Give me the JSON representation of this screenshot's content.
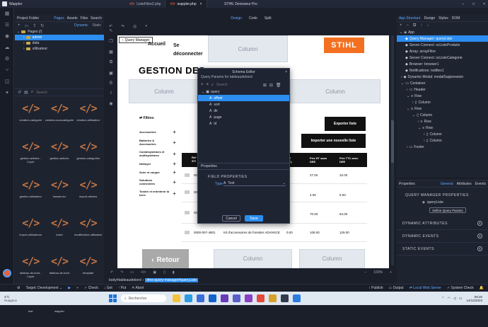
{
  "window": {
    "app_title": "Wappler",
    "title": "STIHL Devisseur Pro",
    "window_controls": [
      "–",
      "□",
      "×"
    ]
  },
  "editor_tabs": [
    {
      "label": "ListeFiltre2.php",
      "active": false
    },
    {
      "label": "wappler.php",
      "active": true
    }
  ],
  "view_modes": [
    "Design",
    "Code",
    "Split"
  ],
  "project": {
    "panel_title": "Project Folder",
    "tabs": [
      "Pages",
      "Assets",
      "Files",
      "Search"
    ],
    "modes": [
      "Dynamic",
      "Static"
    ],
    "tree": [
      {
        "label": "Pages (/)",
        "level": 0,
        "selected": false
      },
      {
        "label": "admin",
        "level": 1,
        "selected": true
      },
      {
        "label": "data",
        "level": 1,
        "selected": false
      },
      {
        "label": "utilisateur",
        "level": 1,
        "selected": false
      }
    ],
    "search_placeholder": "Search",
    "files": [
      "creation-categorie",
      "creation-souscategorie",
      "creation-utilisateur",
      "gestion-articles - Copie",
      "gestion-articles",
      "gestion-categories",
      "gestion-utilisateur",
      "header.inc",
      "import-articles",
      "import-utilisateurs",
      "index",
      "modification-utilisateur",
      "tableau-de-bord - Copie",
      "tableau-de-bord",
      "template",
      "test",
      "wappler"
    ]
  },
  "canvas": {
    "query_manager_label": "Query Manager",
    "nav_links": [
      "Accueil",
      "Se déconnecter"
    ],
    "column_label": "Column",
    "logo": "STIHL",
    "page_title": "GESTION DES",
    "filters_label": "Filtres",
    "filters": [
      "Accessoires",
      "Batteries & Accessoires",
      "Combisystèmes et multisystèmes",
      "Nettoyer",
      "Scier et couper",
      "Solutions connectées",
      "Tondre et entretenir la terre"
    ],
    "btn_export": "Exporter liste",
    "btn_import": "Importer une nouvelle liste",
    "table_headers": [
      "Réf STI",
      "",
      "EE TC)",
      "Prix HT sans DEE",
      "Prix TTC avec DEE"
    ],
    "rows": [
      {
        "ref": "0000",
        "designation": "",
        "ee": "",
        "ht": "27.00",
        "ttc": "32.00"
      },
      {
        "ref": "0000",
        "designation": "",
        "ee": "",
        "ht": "4.00",
        "ttc": "5.00"
      },
      {
        "ref": "0000",
        "designation": "",
        "ee": "",
        "ht": "70.00",
        "ttc": "84.00"
      },
      {
        "ref": "0000-007-4801",
        "designation": "Kit d'accessoires de forestier ADVANCE",
        "ee": "0.00",
        "ht": "108.00",
        "ttc": "129.00"
      }
    ],
    "btn_retour": "Retour"
  },
  "schema_editor": {
    "title": "Schema Editor",
    "subtitle": "Query Params for tableaudebord",
    "search_placeholder": "Search",
    "root": "query",
    "params": [
      "offset",
      "sort",
      "dir",
      "page",
      "id"
    ],
    "selected": "offset",
    "properties_label": "Properties",
    "field_properties": "FIELD PROPERTIES",
    "type_label": "Type",
    "type_value": "Text",
    "cancel": "Cancel",
    "save": "Save"
  },
  "app_structure": {
    "tabs": [
      "App Structure",
      "Design",
      "Styles",
      "DOM"
    ],
    "items": [
      {
        "label": "App",
        "level": 0,
        "selected": false
      },
      {
        "label": "Query Manager: queryListe",
        "level": 1,
        "selected": true
      },
      {
        "label": "Server Connect: scListeProduits",
        "level": 1,
        "selected": false
      },
      {
        "label": "Array: arrayFiltre",
        "level": 1,
        "selected": false
      },
      {
        "label": "Server Connect: scListeCategorie",
        "level": 1,
        "selected": false
      },
      {
        "label": "Browser: browser1",
        "level": 1,
        "selected": false
      },
      {
        "label": "Notifications: notifies1",
        "level": 1,
        "selected": false
      },
      {
        "label": "Dynamic Modal: modalSuppression",
        "level": 1,
        "selected": false
      },
      {
        "label": "Container",
        "level": 1,
        "selected": false
      },
      {
        "label": "Header",
        "level": 2,
        "selected": false
      },
      {
        "label": "Row",
        "level": 2,
        "selected": false
      },
      {
        "label": "Column",
        "level": 3,
        "selected": false
      },
      {
        "label": "Row",
        "level": 2,
        "selected": false
      },
      {
        "label": "Column",
        "level": 3,
        "selected": false
      },
      {
        "label": "Row",
        "level": 4,
        "selected": false
      },
      {
        "label": "Row",
        "level": 4,
        "selected": false
      },
      {
        "label": "Column",
        "level": 5,
        "selected": false
      },
      {
        "label": "Column",
        "level": 5,
        "selected": false
      },
      {
        "label": "Footer",
        "level": 2,
        "selected": false
      }
    ]
  },
  "properties": {
    "title": "Properties",
    "tabs": [
      "General",
      "Attributes",
      "Events"
    ],
    "query_manager_props": "QUERY MANAGER PROPERTIES",
    "query_name": "queryListe",
    "define_button": "Define Query Params",
    "sections": [
      "DYNAMIC ATTRIBUTES",
      "DYNAMIC EVENTS",
      "STATIC EVENTS"
    ]
  },
  "breadcrumb": [
    "body#tableaudebord",
    "dmx-query-manager#queryListe"
  ],
  "zoom": "100%",
  "status": {
    "target_label": "Target: Development",
    "actions": [
      "Check",
      "Get",
      "Put",
      "Abort"
    ],
    "right_actions": [
      "Publish",
      "Output",
      "Local Web Server",
      "System Check"
    ],
    "version": "6.0.2"
  },
  "taskbar": {
    "weather_temp": "4°C",
    "weather_text": "Nuageux",
    "search_placeholder": "Rechercher",
    "time": "08:20",
    "date": "14/12/2023"
  },
  "colors": {
    "accent": "#2c8ef0",
    "stihl": "#f37021",
    "file_icon": "#c27543"
  }
}
